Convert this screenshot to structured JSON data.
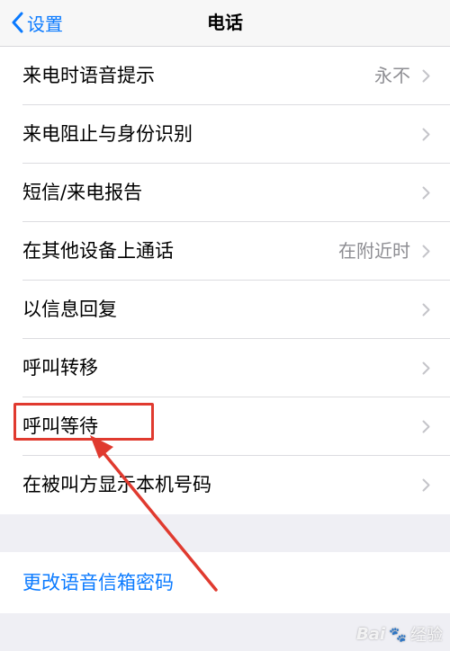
{
  "nav": {
    "back_label": "设置",
    "title": "电话"
  },
  "rows": [
    {
      "label": "来电时语音提示",
      "value": "永不"
    },
    {
      "label": "来电阻止与身份识别",
      "value": ""
    },
    {
      "label": "短信/来电报告",
      "value": ""
    },
    {
      "label": "在其他设备上通话",
      "value": "在附近时"
    },
    {
      "label": "以信息回复",
      "value": ""
    },
    {
      "label": "呼叫转移",
      "value": ""
    },
    {
      "label": "呼叫等待",
      "value": ""
    },
    {
      "label": "在被叫方显示本机号码",
      "value": ""
    }
  ],
  "link": {
    "label": "更改语音信箱密码"
  },
  "annotation": {
    "highlight_color": "#e03a2f",
    "target": "呼叫等待"
  },
  "watermark": {
    "brand": "Bai",
    "paw": "🐾",
    "suffix": "经验"
  },
  "colors": {
    "accent": "#0a7aff",
    "background": "#efeff4",
    "secondary_text": "#8e8e93"
  }
}
